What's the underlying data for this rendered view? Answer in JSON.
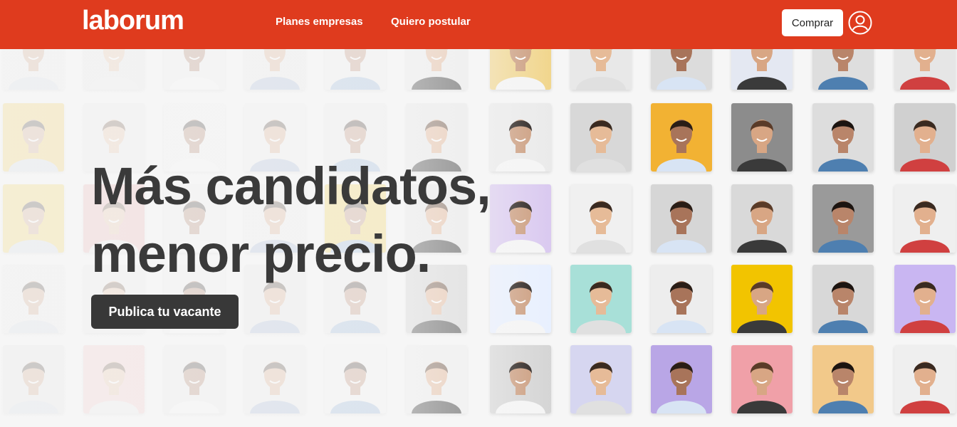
{
  "header": {
    "logo": "laborum",
    "nav": [
      {
        "label": "Planes empresas"
      },
      {
        "label": "Quiero postular"
      }
    ],
    "buy_label": "Comprar",
    "user_icon": "user-circle-icon"
  },
  "hero": {
    "headline_line1": "Más candidatos,",
    "headline_line2": "menor precio.",
    "cta_label": "Publica tu vacante"
  },
  "colors": {
    "brand": "#df3b1e",
    "headline": "#3a3a3a",
    "cta_bg": "#383838"
  },
  "photos": {
    "tile_backgrounds": [
      "#e9e9e9",
      "#e6e6e6",
      "#ececec",
      "#e8e8e8",
      "#eeeeee",
      "#e9e9e9",
      "#f1d58a",
      "#e8e8e8",
      "#dcdcdc",
      "#e4e8f2",
      "#dedede",
      "#e6e6e6",
      "#f2c84a",
      "#e8e8e8",
      "#f0f0f0",
      "#eeeeee",
      "#e9e9e9",
      "#e6e6e6",
      "#eaeaea",
      "#d8d8d8",
      "#f2b233",
      "#8c8c8c",
      "#dddddd",
      "#d0d0d0",
      "#f2d04a",
      "#e8a9a9",
      "#efefef",
      "#ebebeb",
      "#f2d04a",
      "#e6e6e6",
      "#d9c8f0",
      "#f0f0f0",
      "#d6d6d6",
      "#d9d9d9",
      "#9a9a9a",
      "#efefef",
      "#e9e9e9",
      "#e9e9e9",
      "#eeeeee",
      "#e7e7e7",
      "#eaeaea",
      "#cfcfcf",
      "#e8f0ff",
      "#a8e0d8",
      "#ededed",
      "#f2c400",
      "#d8d8d8",
      "#c9b6f2",
      "#e3e3e3",
      "#f2c2c2",
      "#e8e8e8",
      "#eaeaea",
      "#f2f2f2",
      "#ececec",
      "#d4d4d4",
      "#d6d6f0",
      "#b9a6e6",
      "#f0a0a8",
      "#f2c98a",
      "#efefef"
    ]
  }
}
